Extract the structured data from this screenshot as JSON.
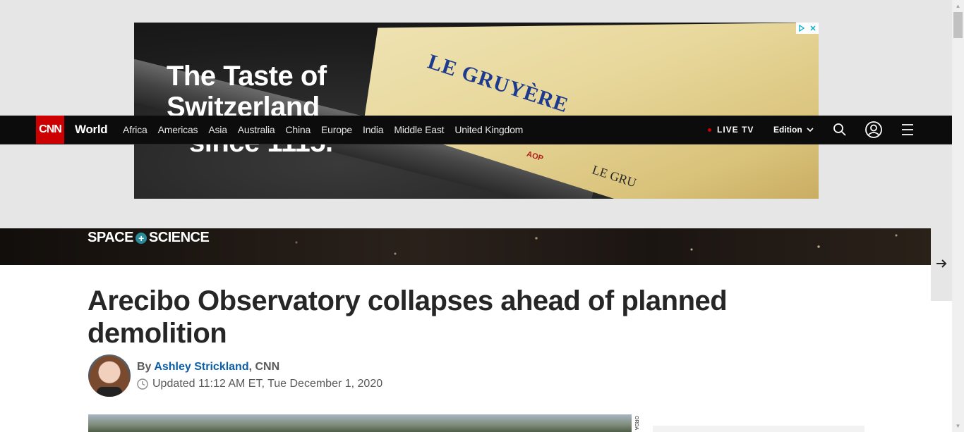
{
  "ad": {
    "headline_line1": "The Taste of",
    "headline_line2": "Switzerland",
    "headline_line3": "since 1115.",
    "brand_text": "LE GRUYÈRE",
    "brand_text_small": "LE GRU",
    "aop_text": "AOP",
    "choice_icons": [
      "adchoices-icon",
      "close-icon"
    ]
  },
  "nav": {
    "logo": "CNN",
    "section": "World",
    "links": [
      "Africa",
      "Americas",
      "Asia",
      "Australia",
      "China",
      "Europe",
      "India",
      "Middle East",
      "United Kingdom"
    ],
    "live_tv": "LIVE TV",
    "edition": "Edition",
    "icons": [
      "search-icon",
      "account-icon",
      "menu-icon"
    ]
  },
  "banner": {
    "label_left": "SPACE",
    "label_plus": "+",
    "label_right": "SCIENCE"
  },
  "article": {
    "headline": "Arecibo Observatory collapses ahead of planned demolition",
    "byline_prefix": "By",
    "author": "Ashley Strickland",
    "outlet": ", CNN",
    "updated": "Updated 11:12 AM ET, Tue December 1, 2020",
    "image_credit": "ORDA"
  },
  "colors": {
    "nav_bg": "#0c0c0c",
    "cnn_red": "#cc0000",
    "link_blue": "#0c5fa6",
    "headline_text": "#262626"
  }
}
